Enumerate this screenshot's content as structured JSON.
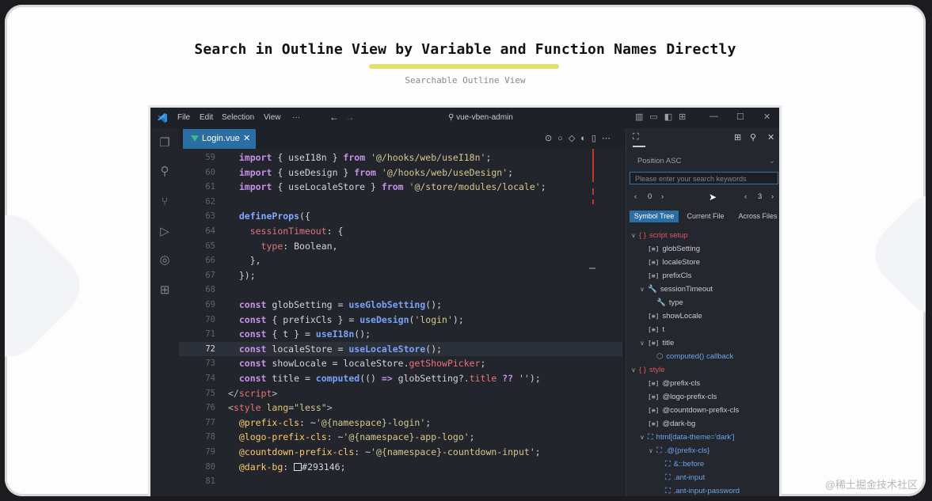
{
  "hero": {
    "title": "Search in Outline View by Variable and Function Names Directly",
    "subtitle": "Searchable Outline View"
  },
  "window": {
    "menu": [
      "File",
      "Edit",
      "Selection",
      "View",
      "···"
    ],
    "search_text": "vue-vben-admin",
    "controls": [
      "—",
      "☐",
      "✕"
    ]
  },
  "editor_tab": {
    "label": "Login.vue",
    "close": "✕"
  },
  "code": {
    "current_line": "72",
    "lines": [
      {
        "n": "59",
        "html": "  <span class='k'>import</span> { useI18n } <span class='k'>from</span> <span class='s'>'@/hooks/web/useI18n'</span>;"
      },
      {
        "n": "60",
        "html": "  <span class='k'>import</span> { useDesign } <span class='k'>from</span> <span class='s'>'@/hooks/web/useDesign'</span>;"
      },
      {
        "n": "61",
        "html": "  <span class='k'>import</span> { useLocaleStore } <span class='k'>from</span> <span class='s'>'@/store/modules/locale'</span>;"
      },
      {
        "n": "62",
        "html": ""
      },
      {
        "n": "63",
        "html": "  <span class='kw'>defineProps</span>({"
      },
      {
        "n": "64",
        "html": "    <span class='pr'>sessionTimeout</span>: {"
      },
      {
        "n": "65",
        "html": "      <span class='pr'>type</span>: Boolean,"
      },
      {
        "n": "66",
        "html": "    },"
      },
      {
        "n": "67",
        "html": "  });"
      },
      {
        "n": "68",
        "html": ""
      },
      {
        "n": "69",
        "html": "  <span class='k'>const</span> globSetting = <span class='f'>useGlobSetting</span>();"
      },
      {
        "n": "70",
        "html": "  <span class='k'>const</span> { prefixCls } = <span class='f'>useDesign</span>(<span class='s'>'login'</span>);"
      },
      {
        "n": "71",
        "html": "  <span class='k'>const</span> { t } = <span class='f'>useI18n</span>();"
      },
      {
        "n": "72",
        "html": "  <span class='k'>const</span> localeStore = <span class='f'>useLocaleStore</span>();"
      },
      {
        "n": "73",
        "html": "  <span class='k'>const</span> showLocale = localeStore.<span class='p'>getShowPicker</span>;"
      },
      {
        "n": "74",
        "html": "  <span class='k'>const</span> title = <span class='f'>computed</span>(() <span class='k'>=&gt;</span> globSetting?.<span class='p'>title</span> <span class='k'>??</span> <span class='s'>''</span>);"
      },
      {
        "n": "75",
        "html": "<span class='gray'>&lt;/</span><span class='t'>script</span><span class='gray'>&gt;</span>"
      },
      {
        "n": "76",
        "html": "<span class='gray'>&lt;</span><span class='t'>style</span> <span class='at'>lang</span>=<span class='s'>\"less\"</span><span class='gray'>&gt;</span>"
      },
      {
        "n": "77",
        "html": "  <span class='y'>@prefix-cls</span>: ~<span class='s'>'@{namespace}-login'</span>;"
      },
      {
        "n": "78",
        "html": "  <span class='y'>@logo-prefix-cls</span>: ~<span class='s'>'@{namespace}-app-logo'</span>;"
      },
      {
        "n": "79",
        "html": "  <span class='y'>@countdown-prefix-cls</span>: ~<span class='s'>'@{namespace}-countdown-input'</span>;"
      },
      {
        "n": "80",
        "html": "  <span class='y'>@dark-bg</span>: <span style='display:inline-block;width:8px;height:8px;border:1px solid #ddd;vertical-align:-1px;'></span>#293146;"
      },
      {
        "n": "81",
        "html": ""
      }
    ]
  },
  "outline": {
    "sort_label": "Position ASC",
    "search_placeholder": "Please enter your search keywords",
    "pager_left": "0",
    "pager_right": "3",
    "tabs": [
      "Symbol Tree",
      "Current File",
      "Across Files"
    ],
    "items": [
      {
        "indent": 0,
        "chev": "∨",
        "icon": "{ }",
        "label": "script setup",
        "cls": "red"
      },
      {
        "indent": 1,
        "chev": "",
        "icon": "[≡]",
        "label": "globSetting",
        "cls": ""
      },
      {
        "indent": 1,
        "chev": "",
        "icon": "[≡]",
        "label": "localeStore",
        "cls": ""
      },
      {
        "indent": 1,
        "chev": "",
        "icon": "[≡]",
        "label": "prefixCls",
        "cls": ""
      },
      {
        "indent": 1,
        "chev": "∨",
        "icon": "🔧",
        "label": "sessionTimeout",
        "cls": ""
      },
      {
        "indent": 2,
        "chev": "",
        "icon": "🔧",
        "label": "type",
        "cls": ""
      },
      {
        "indent": 1,
        "chev": "",
        "icon": "[≡]",
        "label": "showLocale",
        "cls": ""
      },
      {
        "indent": 1,
        "chev": "",
        "icon": "[≡]",
        "label": "t",
        "cls": ""
      },
      {
        "indent": 1,
        "chev": "∨",
        "icon": "[≡]",
        "label": "title",
        "cls": ""
      },
      {
        "indent": 2,
        "chev": "",
        "icon": "⬡",
        "label": "computed() callback",
        "cls": "blue"
      },
      {
        "indent": 0,
        "chev": "∨",
        "icon": "{ }",
        "label": "style",
        "cls": "red"
      },
      {
        "indent": 1,
        "chev": "",
        "icon": "[≡]",
        "label": "@prefix-cls",
        "cls": ""
      },
      {
        "indent": 1,
        "chev": "",
        "icon": "[≡]",
        "label": "@logo-prefix-cls",
        "cls": ""
      },
      {
        "indent": 1,
        "chev": "",
        "icon": "[≡]",
        "label": "@countdown-prefix-cls",
        "cls": ""
      },
      {
        "indent": 1,
        "chev": "",
        "icon": "[≡]",
        "label": "@dark-bg",
        "cls": ""
      },
      {
        "indent": 1,
        "chev": "∨",
        "icon": "⛶",
        "label": "html[data-theme='dark']",
        "cls": "blue"
      },
      {
        "indent": 2,
        "chev": "∨",
        "icon": "⛶",
        "label": ".@{prefix-cls}",
        "cls": "blue"
      },
      {
        "indent": 3,
        "chev": "",
        "icon": "⛶",
        "label": "&::before",
        "cls": "blue"
      },
      {
        "indent": 3,
        "chev": "",
        "icon": "⛶",
        "label": ".ant-input",
        "cls": "blue"
      },
      {
        "indent": 3,
        "chev": "",
        "icon": "⛶",
        "label": ".ant-input-password",
        "cls": "blue"
      }
    ]
  },
  "watermark": "@稀土掘金技术社区"
}
